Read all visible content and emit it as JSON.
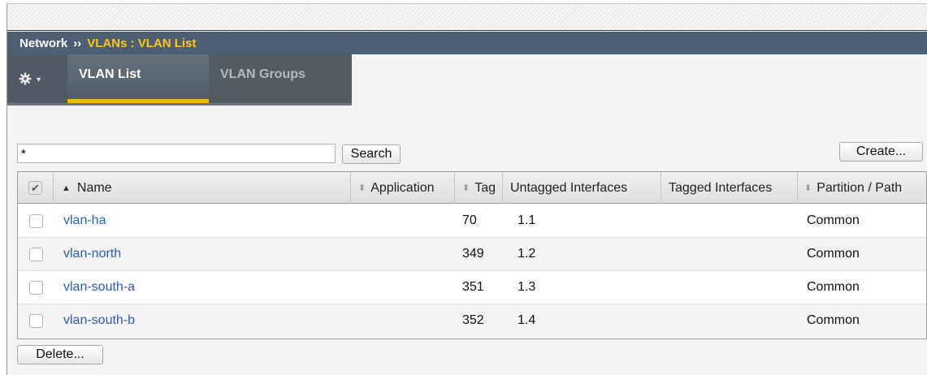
{
  "breadcrumb": {
    "root": "Network",
    "separator": "››",
    "leaf": "VLANs : VLAN List"
  },
  "toolbar": {
    "gear_icon": "gear-icon",
    "gear_caret": "▾"
  },
  "tabs": [
    {
      "label": "VLAN List",
      "active": true
    },
    {
      "label": "VLAN Groups",
      "active": false
    }
  ],
  "search": {
    "value": "*",
    "button_label": "Search"
  },
  "create_label": "Create...",
  "delete_label": "Delete...",
  "columns": {
    "name": "Name",
    "application": "Application",
    "tag": "Tag",
    "untagged": "Untagged Interfaces",
    "tagged": "Tagged Interfaces",
    "partition": "Partition / Path"
  },
  "rows": [
    {
      "name": "vlan-ha",
      "application": "",
      "tag": "70",
      "untagged": "1.1",
      "tagged": "",
      "partition": "Common"
    },
    {
      "name": "vlan-north",
      "application": "",
      "tag": "349",
      "untagged": "1.2",
      "tagged": "",
      "partition": "Common"
    },
    {
      "name": "vlan-south-a",
      "application": "",
      "tag": "351",
      "untagged": "1.3",
      "tagged": "",
      "partition": "Common"
    },
    {
      "name": "vlan-south-b",
      "application": "",
      "tag": "352",
      "untagged": "1.4",
      "tagged": "",
      "partition": "Common"
    }
  ],
  "colors": {
    "title_bar": "#4c5f73",
    "breadcrumb_accent": "#ffc619",
    "active_tab_underline": "#f4b41a",
    "link": "#2b5fb4"
  }
}
